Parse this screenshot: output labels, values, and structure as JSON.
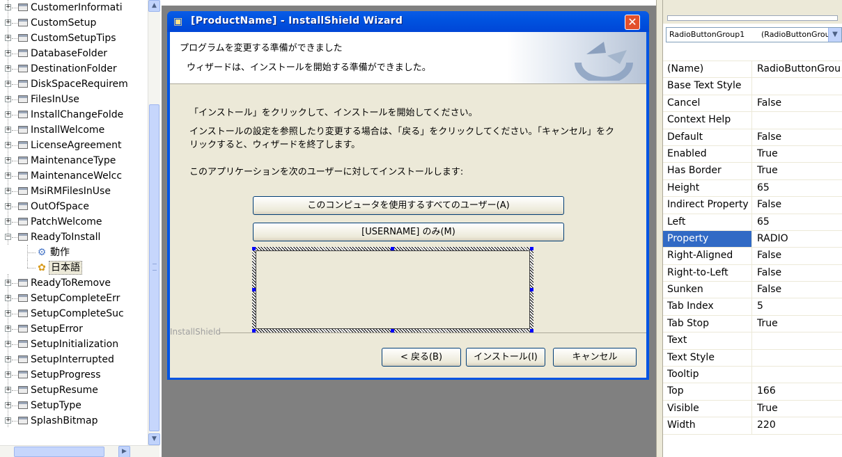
{
  "tree": {
    "items": [
      "CustomerInformati",
      "CustomSetup",
      "CustomSetupTips",
      "DatabaseFolder",
      "DestinationFolder",
      "DiskSpaceRequirem",
      "FilesInUse",
      "InstallChangeFolde",
      "InstallWelcome",
      "LicenseAgreement",
      "MaintenanceType",
      "MaintenanceWelcc",
      "MsiRMFilesInUse",
      "OutOfSpace",
      "PatchWelcome",
      "ReadyToInstall"
    ],
    "children": [
      "動作",
      "日本語"
    ],
    "items_after": [
      "ReadyToRemove",
      "SetupCompleteErr",
      "SetupCompleteSuc",
      "SetupError",
      "SetupInitialization",
      "SetupInterrupted",
      "SetupProgress",
      "SetupResume",
      "SetupType",
      "SplashBitmap"
    ]
  },
  "wizard": {
    "title": "[ProductName] - InstallShield Wizard",
    "heading": "プログラムを変更する準備ができました",
    "subheading": "ウィザードは、インストールを開始する準備ができました。",
    "line1": "「インストール」をクリックして、インストールを開始してください。",
    "line2": "インストールの設定を参照したり変更する場合は、「戻る」をクリックしてください。「キャンセル」をクリックすると、ウィザードを終了します。",
    "line3": "このアプリケーションを次のユーザーに対してインストールします:",
    "option_all": "このコンピュータを使用するすべてのユーザー(A)",
    "option_user": "[USERNAME] のみ(M)",
    "brand": "InstallShield",
    "back_button": "< 戻る(B)",
    "install_button": "インストール(I)",
    "cancel_button": "キャンセル"
  },
  "properties": {
    "object_name": "RadioButtonGroup1",
    "object_type": "(RadioButtonGroup)",
    "rows": [
      {
        "name": "(Name)",
        "value": "RadioButtonGrou"
      },
      {
        "name": "Base Text Style",
        "value": ""
      },
      {
        "name": "Cancel",
        "value": "False"
      },
      {
        "name": "Context Help",
        "value": ""
      },
      {
        "name": "Default",
        "value": "False"
      },
      {
        "name": "Enabled",
        "value": "True"
      },
      {
        "name": "Has Border",
        "value": "True"
      },
      {
        "name": "Height",
        "value": "65"
      },
      {
        "name": "Indirect Property",
        "value": "False"
      },
      {
        "name": "Left",
        "value": "65"
      },
      {
        "name": "Property",
        "value": "RADIO"
      },
      {
        "name": "Right-Aligned",
        "value": "False"
      },
      {
        "name": "Right-to-Left",
        "value": "False"
      },
      {
        "name": "Sunken",
        "value": "False"
      },
      {
        "name": "Tab Index",
        "value": "5"
      },
      {
        "name": "Tab Stop",
        "value": "True"
      },
      {
        "name": "Text",
        "value": ""
      },
      {
        "name": "Text Style",
        "value": ""
      },
      {
        "name": "Tooltip",
        "value": ""
      },
      {
        "name": "Top",
        "value": "166"
      },
      {
        "name": "Visible",
        "value": "True"
      },
      {
        "name": "Width",
        "value": "220"
      }
    ],
    "selected_row": "Property"
  },
  "colors": {
    "titlebar": "#0054e3",
    "selection": "#316ac5",
    "dialog_face": "#ece9d8",
    "workspace": "#808080"
  }
}
